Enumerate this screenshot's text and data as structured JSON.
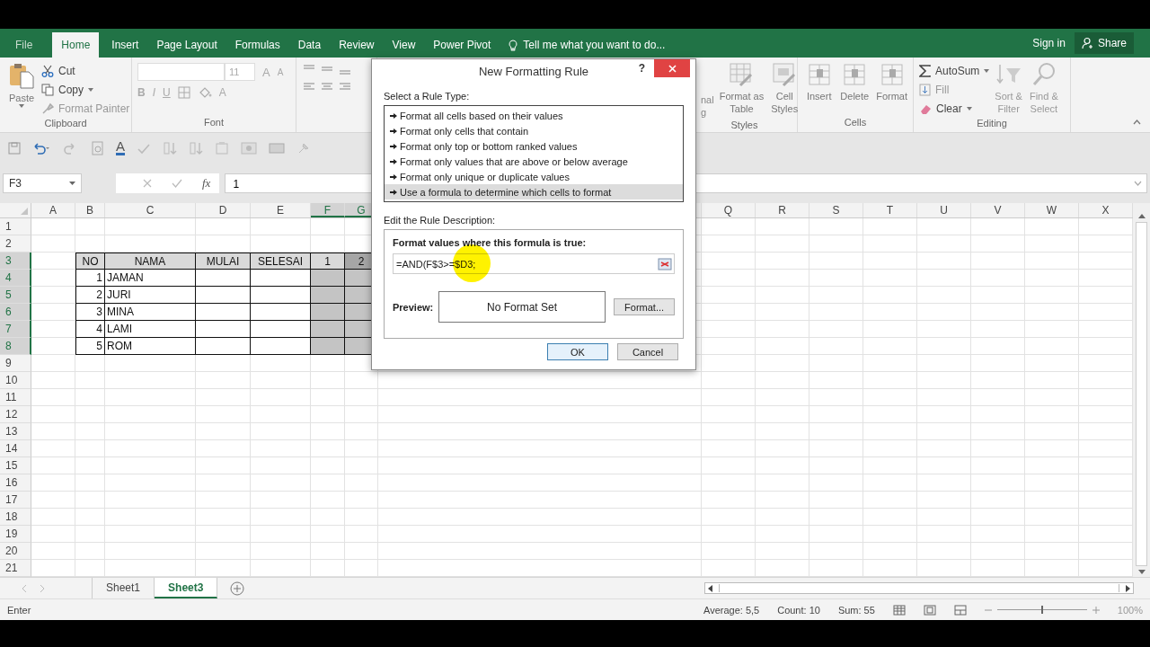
{
  "ribbon": {
    "tabs": [
      {
        "label": "File",
        "selected": false
      },
      {
        "label": "Home",
        "selected": true
      },
      {
        "label": "Insert",
        "selected": false
      },
      {
        "label": "Page Layout",
        "selected": false
      },
      {
        "label": "Formulas",
        "selected": false
      },
      {
        "label": "Data",
        "selected": false
      },
      {
        "label": "Review",
        "selected": false
      },
      {
        "label": "View",
        "selected": false
      },
      {
        "label": "Power Pivot",
        "selected": false
      }
    ],
    "tell_me": "Tell me what you want to do...",
    "sign_in": "Sign in",
    "share": "Share",
    "clipboard": {
      "paste": "Paste",
      "cut": "Cut",
      "copy": "Copy",
      "format_painter": "Format Painter",
      "label": "Clipboard"
    },
    "font": {
      "size": "11",
      "grow": "A",
      "shrink": "A",
      "bold": "B",
      "italic": "I",
      "underline": "U",
      "font_color": "A",
      "label": "Font"
    },
    "styles": {
      "conditional_top": "nal",
      "conditional_bottom": "g",
      "format_as_table": [
        "Format as",
        "Table"
      ],
      "cell_styles": [
        "Cell",
        "Styles"
      ],
      "label": "Styles"
    },
    "cells": {
      "buttons": [
        "Insert",
        "Delete",
        "Format"
      ],
      "label": "Cells"
    },
    "editing": {
      "autosum": "AutoSum",
      "fill": "Fill",
      "clear": "Clear",
      "sort": [
        "Sort &",
        "Filter"
      ],
      "find": [
        "Find &",
        "Select"
      ],
      "label": "Editing"
    }
  },
  "quick_access": {
    "font_color": "A"
  },
  "formula_bar": {
    "name_box": "F3",
    "function_label": "fx",
    "value": "1"
  },
  "sheet": {
    "columns": [
      "A",
      "B",
      "C",
      "D",
      "E",
      "F",
      "G",
      "Q",
      "R",
      "S",
      "T",
      "U",
      "V",
      "W",
      "X"
    ],
    "rows": [
      {
        "number": "1"
      },
      {
        "number": "2"
      },
      {
        "number": "3",
        "cells": [
          {
            "kind": "heading",
            "text": "NO",
            "selected": false
          },
          {
            "kind": "heading",
            "text": "NAMA",
            "selected": false
          },
          {
            "kind": "heading",
            "text": "MULAI",
            "selected": false
          },
          {
            "kind": "heading",
            "text": "SELESAI",
            "selected": false
          },
          {
            "kind": "heading",
            "text": "1",
            "selected": false
          },
          {
            "kind": "heading",
            "text": "2",
            "selected": true
          }
        ]
      },
      {
        "number": "4",
        "cells": [
          {
            "kind": "number",
            "text": "1",
            "selected": false
          },
          {
            "kind": "text",
            "text": "JAMAN",
            "selected": false
          },
          {
            "kind": "blank",
            "selected": false
          },
          {
            "kind": "blank",
            "selected": false
          },
          {
            "kind": "blank",
            "selected": true
          },
          {
            "kind": "blank",
            "selected": true
          }
        ]
      },
      {
        "number": "5",
        "cells": [
          {
            "kind": "number",
            "text": "2",
            "selected": false
          },
          {
            "kind": "text",
            "text": "JURI",
            "selected": false
          },
          {
            "kind": "blank",
            "selected": false
          },
          {
            "kind": "blank",
            "selected": false
          },
          {
            "kind": "blank",
            "selected": true
          },
          {
            "kind": "blank",
            "selected": true
          }
        ]
      },
      {
        "number": "6",
        "cells": [
          {
            "kind": "number",
            "text": "3",
            "selected": false
          },
          {
            "kind": "text",
            "text": "MINA",
            "selected": false
          },
          {
            "kind": "blank",
            "selected": false
          },
          {
            "kind": "blank",
            "selected": false
          },
          {
            "kind": "blank",
            "selected": true
          },
          {
            "kind": "blank",
            "selected": true
          }
        ]
      },
      {
        "number": "7",
        "cells": [
          {
            "kind": "number",
            "text": "4",
            "selected": false
          },
          {
            "kind": "text",
            "text": "LAMI",
            "selected": false
          },
          {
            "kind": "blank",
            "selected": false
          },
          {
            "kind": "blank",
            "selected": false
          },
          {
            "kind": "blank",
            "selected": true
          },
          {
            "kind": "blank",
            "selected": true
          }
        ]
      },
      {
        "number": "8",
        "cells": [
          {
            "kind": "number",
            "text": "5",
            "selected": false
          },
          {
            "kind": "text",
            "text": "ROM",
            "selected": false
          },
          {
            "kind": "blank",
            "selected": false
          },
          {
            "kind": "blank",
            "selected": false
          },
          {
            "kind": "blank",
            "selected": true
          },
          {
            "kind": "blank",
            "selected": true
          }
        ]
      },
      {
        "number": "9"
      },
      {
        "number": "10"
      },
      {
        "number": "11"
      },
      {
        "number": "12"
      },
      {
        "number": "13"
      },
      {
        "number": "14"
      },
      {
        "number": "15"
      },
      {
        "number": "16"
      },
      {
        "number": "17"
      },
      {
        "number": "18"
      },
      {
        "number": "19"
      },
      {
        "number": "20"
      },
      {
        "number": "21"
      }
    ]
  },
  "dialog": {
    "title": "New Formatting Rule",
    "help": "?",
    "rule_type_label": "Select a Rule Type:",
    "rule_types": [
      {
        "label": "Format all cells based on their values",
        "selected": false
      },
      {
        "label": "Format only cells that contain",
        "selected": false
      },
      {
        "label": "Format only top or bottom ranked values",
        "selected": false
      },
      {
        "label": "Format only values that are above or below average",
        "selected": false
      },
      {
        "label": "Format only unique or duplicate values",
        "selected": false
      },
      {
        "label": "Use a formula to determine which cells to format",
        "selected": true
      }
    ],
    "description_label": "Edit the Rule Description:",
    "formula_label": "Format values where this formula is true:",
    "formula": "=AND(F$3>=$D3;",
    "preview_label": "Preview:",
    "preview": "No Format Set",
    "format_button": "Format...",
    "ok": "OK",
    "cancel": "Cancel"
  },
  "sheet_tabs": [
    {
      "label": "Sheet1",
      "selected": false
    },
    {
      "label": "Sheet3",
      "selected": true
    }
  ],
  "status_bar": {
    "mode": "Enter",
    "average": "Average: 5,5",
    "count": "Count: 10",
    "sum": "Sum: 55",
    "zoom": "100%",
    "zoom_slider": {
      "level": 0.5
    }
  }
}
